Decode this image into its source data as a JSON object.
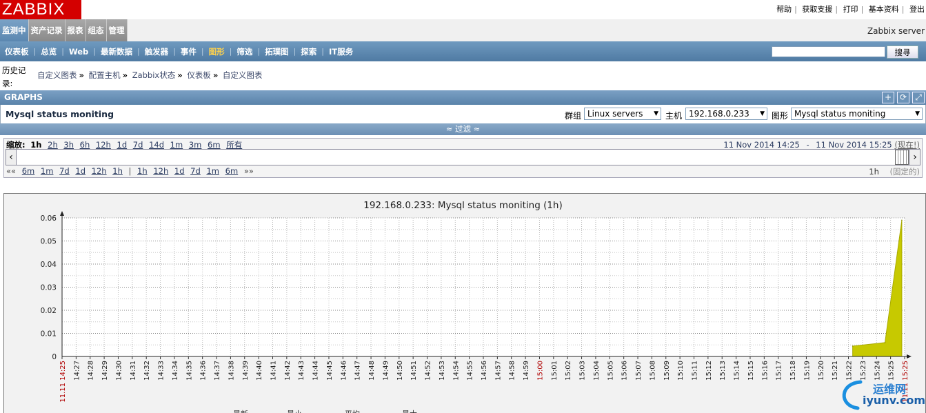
{
  "logo": "ZABBIX",
  "top_links": [
    "帮助",
    "获取支援",
    "打印",
    "基本资料",
    "登出"
  ],
  "main_menu": [
    "监测中",
    "资产记录",
    "报表",
    "组态",
    "管理"
  ],
  "server_name": "Zabbix server",
  "sub_menu": [
    "仪表板",
    "总览",
    "Web",
    "最新数据",
    "触发器",
    "事件",
    "图形",
    "筛选",
    "拓璞图",
    "探索",
    "IT服务"
  ],
  "search": {
    "value": "",
    "button": "搜寻"
  },
  "history": {
    "label": "历史记录:",
    "crumbs": [
      "自定义图表",
      "配置主机",
      "Zabbix状态",
      "仪表板",
      "自定义图表"
    ],
    "separator": "»"
  },
  "graphs_header": "GRAPHS",
  "graph_title": "Mysql status moniting",
  "selectors": {
    "group_label": "群组",
    "group_value": "Linux servers",
    "host_label": "主机",
    "host_value": "192.168.0.233",
    "graph_label": "图形",
    "graph_value": "Mysql status moniting"
  },
  "filter": "≈ 过滤 ≈",
  "zoom": {
    "label": "缩放:",
    "options": [
      "1h",
      "2h",
      "3h",
      "6h",
      "12h",
      "1d",
      "7d",
      "14d",
      "1m",
      "3m",
      "6m",
      "所有"
    ],
    "current": "1h",
    "date_from": "11 Nov 2014 14:25",
    "date_dash": "-",
    "date_to": "11 Nov 2014 15:25",
    "now": "(现在!)"
  },
  "nav": {
    "back": "««",
    "back_opts": [
      "6m",
      "1m",
      "7d",
      "1d",
      "12h",
      "1h"
    ],
    "divider": "|",
    "fwd_opts": [
      "1h",
      "12h",
      "1d",
      "7d",
      "1m",
      "6m"
    ],
    "fwd": "»»",
    "period": "1h",
    "fixed": "(固定的)"
  },
  "chart_data": {
    "type": "area",
    "title": "192.168.0.233: Mysql status moniting (1h)",
    "y_ticks": [
      "0",
      "0.01",
      "0.02",
      "0.03",
      "0.04",
      "0.05",
      "0.06"
    ],
    "ylim": [
      0,
      0.06
    ],
    "x_ticks": [
      "11.11 14:25",
      "14:27",
      "14:28",
      "14:29",
      "14:30",
      "14:31",
      "14:32",
      "14:33",
      "14:34",
      "14:35",
      "14:36",
      "14:37",
      "14:38",
      "14:39",
      "14:40",
      "14:41",
      "14:42",
      "14:43",
      "14:44",
      "14:45",
      "14:46",
      "14:47",
      "14:48",
      "14:49",
      "14:50",
      "14:51",
      "14:52",
      "14:53",
      "14:54",
      "14:55",
      "14:56",
      "14:57",
      "14:58",
      "14:59",
      "15:00",
      "15:01",
      "15:02",
      "15:03",
      "15:04",
      "15:05",
      "15:06",
      "15:07",
      "15:08",
      "15:09",
      "15:10",
      "15:11",
      "15:12",
      "15:13",
      "15:14",
      "15:15",
      "15:16",
      "15:17",
      "15:18",
      "15:19",
      "15:20",
      "15:21",
      "15:22",
      "15:23",
      "15:24",
      "15:25",
      "11.11 15:25"
    ],
    "highlighted_ticks": [
      "11.11 14:25",
      "15:00",
      "11.11 15:25"
    ],
    "x_minutes_range": [
      0,
      60
    ],
    "points": [
      {
        "minute": 56.3,
        "value": 0.0045
      },
      {
        "minute": 58.6,
        "value": 0.006
      },
      {
        "minute": 59.8,
        "value": 0.059
      }
    ],
    "grid": true,
    "fill_color": "#c7c900",
    "accent_color": "#b00000"
  },
  "legend_stub": [
    "最新",
    "最小",
    "平均",
    "最大"
  ],
  "watermark": {
    "text1": "运维网",
    "text2": "iyunv.com"
  }
}
